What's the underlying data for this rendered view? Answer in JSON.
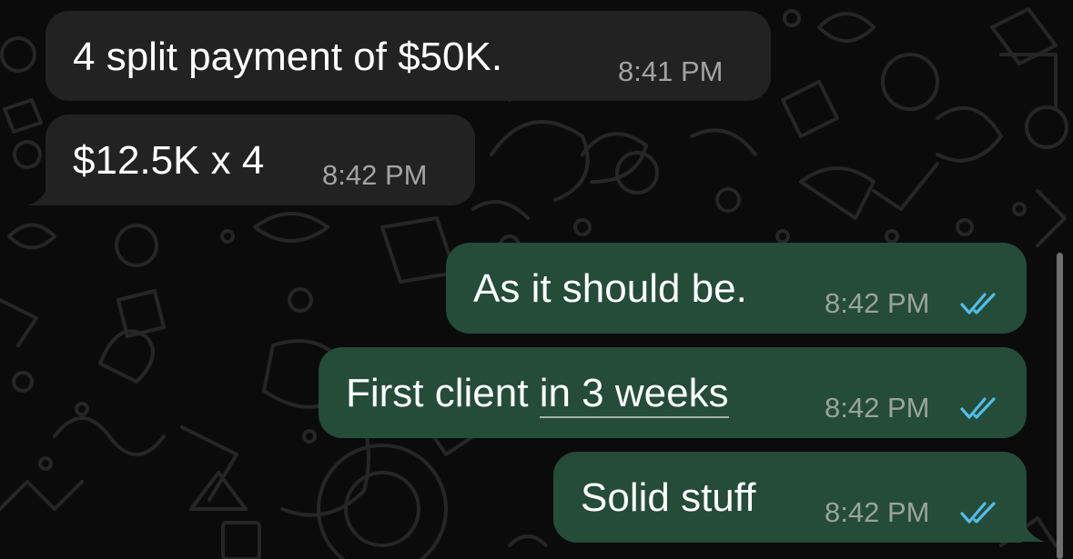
{
  "chat": {
    "messages": [
      {
        "direction": "incoming",
        "text": "4 split payment of $50K.",
        "time": "8:41 PM"
      },
      {
        "direction": "incoming",
        "text": "$12.5K x 4",
        "time": "8:42 PM"
      },
      {
        "direction": "outgoing",
        "text": "As it should be.",
        "time": "8:42 PM",
        "status": "read"
      },
      {
        "direction": "outgoing",
        "text_plain": "First client ",
        "text_link": "in 3 weeks",
        "time": "8:42 PM",
        "status": "read"
      },
      {
        "direction": "outgoing",
        "text": "Solid stuff",
        "time": "8:42 PM",
        "status": "read"
      }
    ]
  },
  "colors": {
    "background": "#0b0b0b",
    "incoming_bubble": "#222222",
    "outgoing_bubble": "#244c39",
    "read_ticks": "#53bdeb"
  },
  "icons": {
    "read_receipt": "double-check-icon"
  }
}
